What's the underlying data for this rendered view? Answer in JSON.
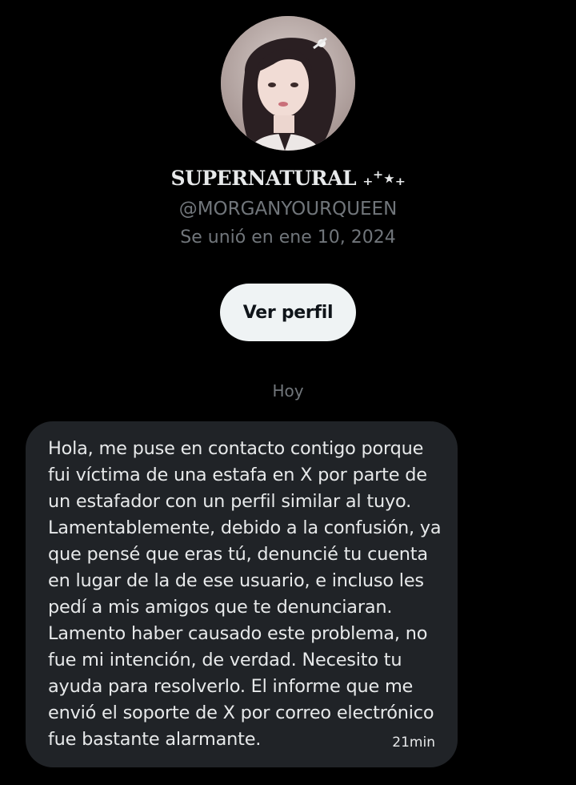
{
  "profile": {
    "display_name": "SUPERNATURAL ₊⁺⋆₊",
    "handle": "@MORGANYOURQUEEN",
    "joined": "Se unió en ene 10, 2024",
    "view_profile_label": "Ver perfil"
  },
  "conversation": {
    "date_separator": "Hoy",
    "messages": [
      {
        "lines": [
          "Hola, me puse en contacto contigo porque",
          "fui víctima de una estafa en X por parte de",
          "un estafador con un perfil similar al tuyo.",
          "Lamentablemente, debido a la confusión, ya",
          "que pensé que eras tú, denuncié tu cuenta",
          "en lugar de la de ese usuario, e incluso les",
          "pedí a mis amigos que te denunciaran.",
          "Lamento haber causado este problema, no",
          "fue mi intención, de verdad. Necesito tu",
          "ayuda para resolverlo. El informe que me",
          "envió el soporte de X por correo electrónico",
          "fue bastante alarmante."
        ],
        "time": "21min"
      }
    ]
  },
  "colors": {
    "background": "#000000",
    "bubble": "#202327",
    "text_primary": "#e7e9ea",
    "text_secondary": "#71767b",
    "button_bg": "#eff3f4"
  }
}
